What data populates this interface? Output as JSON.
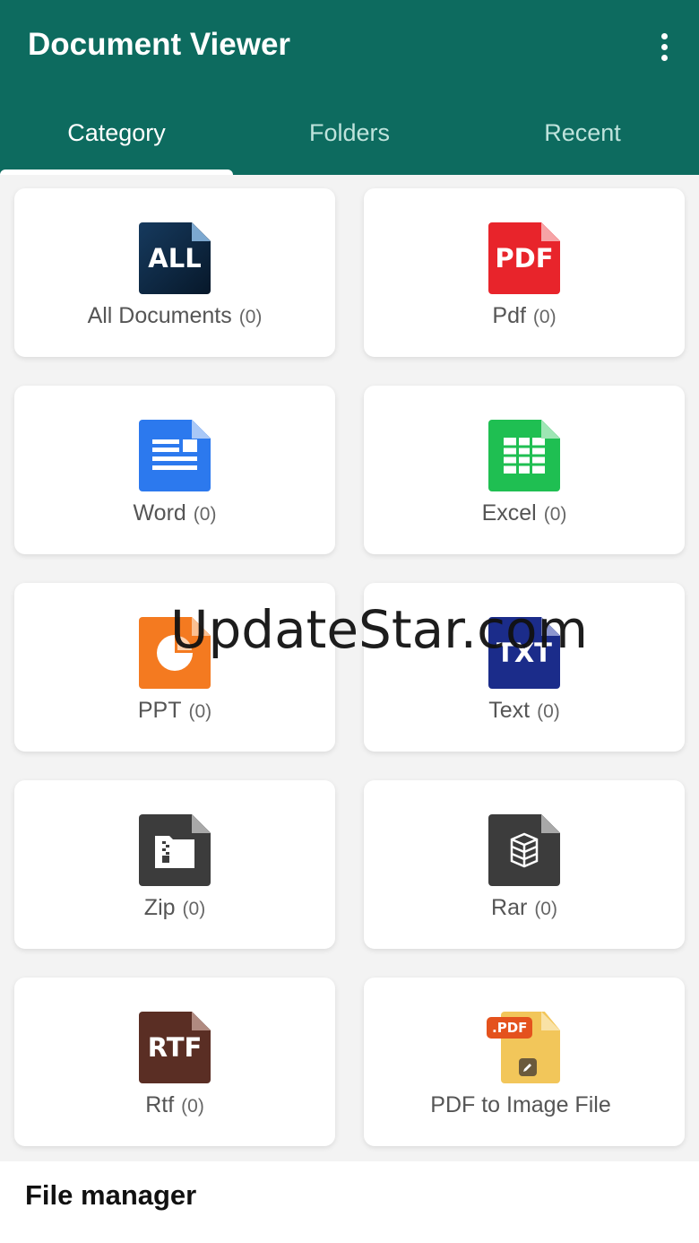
{
  "app": {
    "title": "Document Viewer",
    "menu_icon": "more-vert-icon"
  },
  "tabs": [
    {
      "label": "Category",
      "active": true
    },
    {
      "label": "Folders",
      "active": false
    },
    {
      "label": "Recent",
      "active": false
    }
  ],
  "categories": [
    {
      "label": "All Documents",
      "count": "(0)",
      "icon_text": "ALL",
      "icon": "all-documents-icon",
      "color": "#0e3050"
    },
    {
      "label": "Pdf",
      "count": "(0)",
      "icon_text": "PDF",
      "icon": "pdf-icon",
      "color": "#e8242b"
    },
    {
      "label": "Word",
      "count": "(0)",
      "icon": "word-icon",
      "color": "#2c79ee"
    },
    {
      "label": "Excel",
      "count": "(0)",
      "icon": "excel-icon",
      "color": "#1fbf52"
    },
    {
      "label": "PPT",
      "count": "(0)",
      "icon": "ppt-icon",
      "color": "#f47a20"
    },
    {
      "label": "Text",
      "count": "(0)",
      "icon_text": "TXT",
      "icon": "text-icon",
      "color": "#1b2c8a"
    },
    {
      "label": "Zip",
      "count": "(0)",
      "icon": "zip-icon",
      "color": "#3c3c3c"
    },
    {
      "label": "Rar",
      "count": "(0)",
      "icon": "rar-icon",
      "color": "#3c3c3c"
    },
    {
      "label": "Rtf",
      "count": "(0)",
      "icon_text": "RTF",
      "icon": "rtf-icon",
      "color": "#5a2e24"
    },
    {
      "label": "PDF to Image File",
      "count": "",
      "icon_text": ".PDF",
      "icon": "pdf-to-image-icon",
      "color": "#f2c65a"
    }
  ],
  "watermark": "UpdateStar.com",
  "footer": {
    "title": "File manager"
  }
}
